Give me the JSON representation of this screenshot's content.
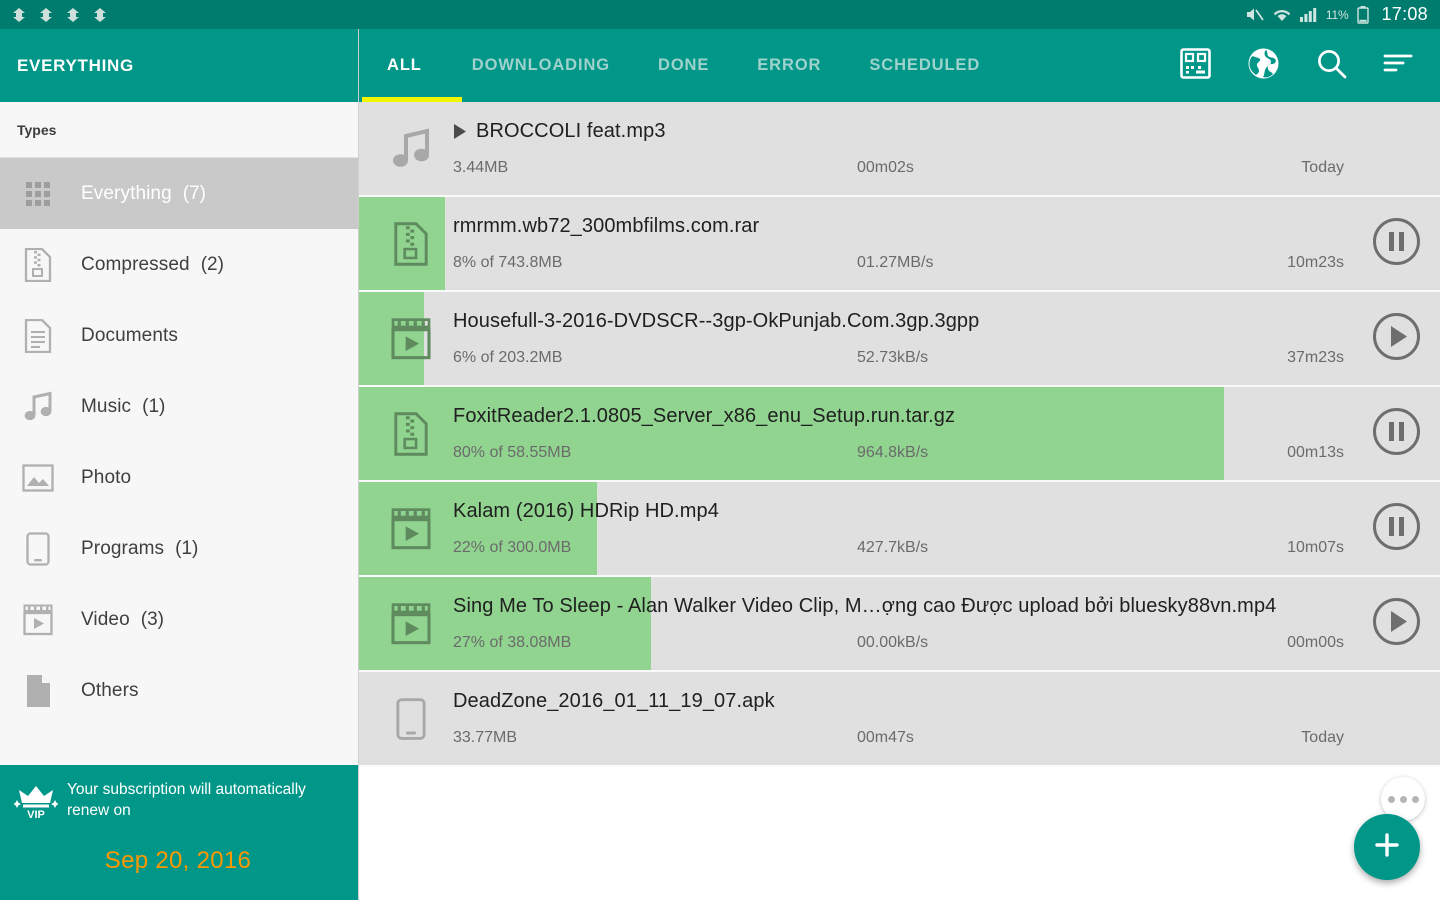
{
  "statusbar": {
    "icons": [
      "nav-diamond-icon",
      "nav-diamond-icon",
      "nav-diamond-icon",
      "nav-diamond-icon"
    ],
    "mute_icon": "volume-mute-icon",
    "wifi_icon": "wifi-icon",
    "signal_icon": "cell-signal-icon",
    "battery_percent": "11%",
    "battery_icon": "battery-icon",
    "clock": "17:08"
  },
  "sidebar": {
    "title": "EVERYTHING",
    "section_label": "Types",
    "items": [
      {
        "label": "Everything",
        "count": "(7)",
        "icon": "grid-icon",
        "active": true
      },
      {
        "label": "Compressed",
        "count": "(2)",
        "icon": "archive-icon",
        "active": false
      },
      {
        "label": "Documents",
        "count": "",
        "icon": "document-icon",
        "active": false
      },
      {
        "label": "Music",
        "count": "(1)",
        "icon": "music-note-icon",
        "active": false
      },
      {
        "label": "Photo",
        "count": "",
        "icon": "image-icon",
        "active": false
      },
      {
        "label": "Programs",
        "count": "(1)",
        "icon": "phone-icon",
        "active": false
      },
      {
        "label": "Video",
        "count": "(3)",
        "icon": "video-clip-icon",
        "active": false
      },
      {
        "label": "Others",
        "count": "",
        "icon": "file-icon",
        "active": false
      }
    ],
    "vip": {
      "icon": "vip-crown-icon",
      "message": "Your subscription will automatically renew on",
      "date": "Sep 20, 2016",
      "date_color": "#FF9800"
    }
  },
  "appbar": {
    "tabs": [
      {
        "label": "ALL",
        "active": true
      },
      {
        "label": "DOWNLOADING",
        "active": false
      },
      {
        "label": "DONE",
        "active": false
      },
      {
        "label": "ERROR",
        "active": false
      },
      {
        "label": "SCHEDULED",
        "active": false
      }
    ],
    "indicator_color": "#F5F500",
    "icons": [
      {
        "name": "qr-code-icon"
      },
      {
        "name": "globe-icon"
      },
      {
        "name": "search-icon"
      },
      {
        "name": "sort-icon"
      }
    ]
  },
  "downloads": [
    {
      "title": "BROCCOLI feat.mp3",
      "title_prefix_icon": "play-triangle-icon",
      "size": "3.44MB",
      "speed": "00m02s",
      "time": "Today",
      "progress": 0,
      "file_icon": "music-note-icon",
      "action": "none"
    },
    {
      "title": "rmrmm.wb72_300mbfilms.com.rar",
      "title_prefix_icon": "",
      "size": "8% of 743.8MB",
      "speed": "01.27MB/s",
      "time": "10m23s",
      "progress": 8,
      "file_icon": "archive-icon",
      "action": "pause-icon"
    },
    {
      "title": "Housefull-3-2016-DVDSCR--3gp-OkPunjab.Com.3gp.3gpp",
      "title_prefix_icon": "",
      "size": "6% of 203.2MB",
      "speed": "52.73kB/s",
      "time": "37m23s",
      "progress": 6,
      "file_icon": "video-clip-icon",
      "action": "play-icon"
    },
    {
      "title": "FoxitReader2.1.0805_Server_x86_enu_Setup.run.tar.gz",
      "title_prefix_icon": "",
      "size": "80% of 58.55MB",
      "speed": "964.8kB/s",
      "time": "00m13s",
      "progress": 80,
      "file_icon": "archive-icon",
      "action": "pause-icon"
    },
    {
      "title": "Kalam (2016) HDRip HD.mp4",
      "title_prefix_icon": "",
      "size": "22% of 300.0MB",
      "speed": "427.7kB/s",
      "time": "10m07s",
      "progress": 22,
      "file_icon": "video-clip-icon",
      "action": "pause-icon"
    },
    {
      "title": "Sing Me To Sleep - Alan Walker  Video Clip, M…ợng cao  Được upload bởi bluesky88vn.mp4",
      "title_prefix_icon": "",
      "size": "27% of 38.08MB",
      "speed": "00.00kB/s",
      "time": "00m00s",
      "progress": 27,
      "file_icon": "video-clip-icon",
      "action": "play-icon"
    },
    {
      "title": "DeadZone_2016_01_11_19_07.apk",
      "title_prefix_icon": "",
      "size": "33.77MB",
      "speed": "00m47s",
      "time": "Today",
      "progress": 0,
      "file_icon": "phone-icon",
      "action": "none"
    }
  ],
  "floating": {
    "more_icon": "more-horizontal-icon",
    "add_icon": "plus-icon",
    "add_color": "#009688"
  }
}
